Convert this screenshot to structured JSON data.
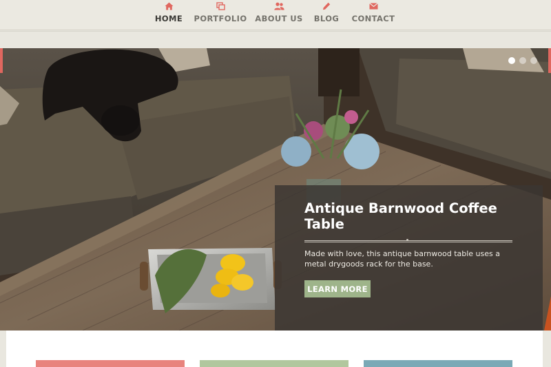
{
  "nav": {
    "items": [
      {
        "label": "HOME",
        "icon": "home-icon",
        "active": true
      },
      {
        "label": "PORTFOLIO",
        "icon": "portfolio-icon",
        "active": false
      },
      {
        "label": "ABOUT US",
        "icon": "users-icon",
        "active": false
      },
      {
        "label": "BLOG",
        "icon": "pencil-icon",
        "active": false
      },
      {
        "label": "CONTACT",
        "icon": "envelope-icon",
        "active": false
      }
    ],
    "icon_color": "#e0675f"
  },
  "slider": {
    "slide_count": 3,
    "active_slide": 1,
    "caption": {
      "title": "Antique Barnwood Coffee Table",
      "text": "Made with love, this antique barnwood table uses a metal drygoods rack for the base.",
      "button_label": "LEARN MORE"
    }
  },
  "colors": {
    "accent_red": "#e0675f",
    "accent_green": "#9eb48a",
    "accent_blue": "#79a8b4",
    "feature_red": "#e8837d",
    "feature_green": "#b1c79e",
    "feature_blue": "#7aa9b6"
  }
}
